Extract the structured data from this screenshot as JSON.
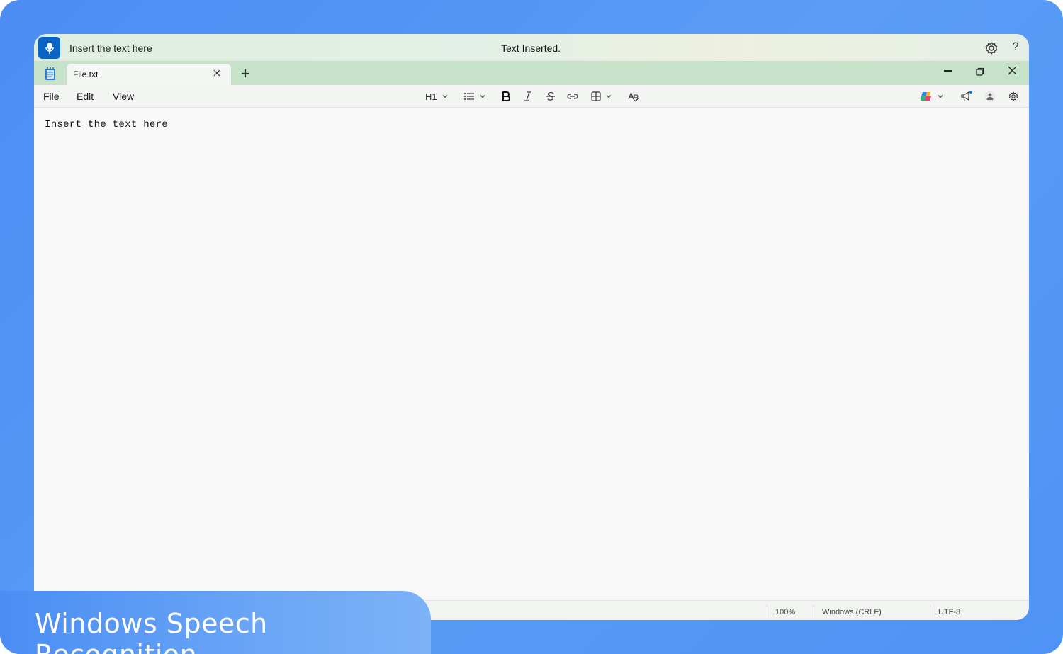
{
  "overlay": {
    "caption": "Windows Speech Recognition"
  },
  "speech_bar": {
    "recognized_text": "Insert the text here",
    "status": "Text Inserted.",
    "help_glyph": "?",
    "icons": [
      "microphone-icon",
      "gear-icon",
      "help-icon"
    ]
  },
  "tab_bar": {
    "tab_label": "File.txt",
    "icons": [
      "notepad-icon",
      "close-icon",
      "plus-icon",
      "minimize-icon",
      "restore-icon",
      "close-window-icon"
    ]
  },
  "menu": {
    "items": [
      "File",
      "Edit",
      "View"
    ]
  },
  "toolbar": {
    "heading": "H1",
    "icons": [
      "list-icon",
      "bold-icon",
      "italic-icon",
      "strikethrough-icon",
      "link-icon",
      "table-icon",
      "clear-format-icon",
      "copilot-icon",
      "announcement-icon",
      "account-icon",
      "settings-icon"
    ]
  },
  "editor": {
    "content": "Insert the text here"
  },
  "status_bar": {
    "zoom": "100%",
    "line_ending": "Windows (CRLF)",
    "encoding": "UTF-8"
  },
  "colors": {
    "background": "#4b8df3",
    "mic_button": "#0b63c4",
    "tab_bar": "#c6e2c9",
    "editor": "#f8f8f8"
  }
}
